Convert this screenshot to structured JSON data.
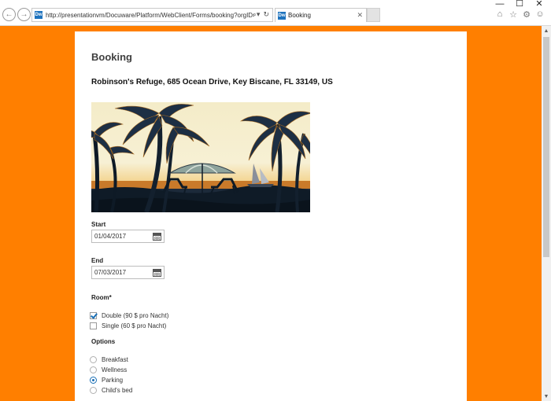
{
  "browser": {
    "url": "http://presentationvm/Docuware/Platform/WebClient/Forms/booking?orgID=1",
    "favicon_text": "Dw",
    "tab_title": "Booking",
    "tab_close": "✕",
    "back_icon": "←",
    "forward_icon": "→",
    "search_icon": "⌕▾",
    "refresh_icon": "↻",
    "minimize": "—",
    "maximize": "☐",
    "close": "✕",
    "home_icon": "⌂",
    "favorites_icon": "☆",
    "settings_icon": "⚙",
    "smiley_icon": "☺"
  },
  "scrollbar": {
    "up": "▲",
    "down": "▼"
  },
  "colors": {
    "page_background": "#ff7f00",
    "accent": "#1a6fb5"
  },
  "form": {
    "title": "Booking",
    "address": "Robinson's Refuge, 685 Ocean Drive, Key Biscane, FL 33149, US",
    "image_subject": "beach with palm trees, umbrella, two lounge chairs and a sailboat at sunset",
    "start": {
      "label": "Start",
      "value": "01/04/2017"
    },
    "end": {
      "label": "End",
      "value": "07/03/2017"
    },
    "room": {
      "label": "Room*",
      "options": [
        {
          "label": "Double (90 $ pro Nacht)",
          "checked": true
        },
        {
          "label": "Single (60 $ pro Nacht)",
          "checked": false
        }
      ]
    },
    "options": {
      "label": "Options",
      "items": [
        {
          "label": "Breakfast",
          "selected": false
        },
        {
          "label": "Wellness",
          "selected": false
        },
        {
          "label": "Parking",
          "selected": true
        },
        {
          "label": "Child's bed",
          "selected": false
        }
      ]
    }
  }
}
